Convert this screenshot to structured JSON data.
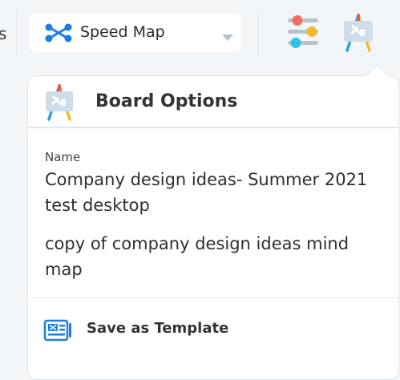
{
  "topbar": {
    "left_edge_text": "s",
    "map_selector": {
      "label": "Speed Map",
      "icon": "mindmap-icon"
    },
    "sliders_icon": "sliders-icon",
    "board_icon": "board-easel-icon"
  },
  "board_options": {
    "title": "Board Options",
    "header_icon": "board-easel-icon",
    "name_label": "Name",
    "name_value": "Company design ideas- Summer 2021 test desktop",
    "description_value": "copy of company design ideas mind map",
    "menu": [
      {
        "label": "Save as Template",
        "icon": "template-icon"
      }
    ]
  },
  "colors": {
    "accent_blue": "#1a7fe0",
    "background": "#f3f6f9",
    "panel": "#ffffff",
    "easel_red": "#ef5a52",
    "easel_yellow": "#f6b82e",
    "easel_blue": "#2b9fe6"
  }
}
